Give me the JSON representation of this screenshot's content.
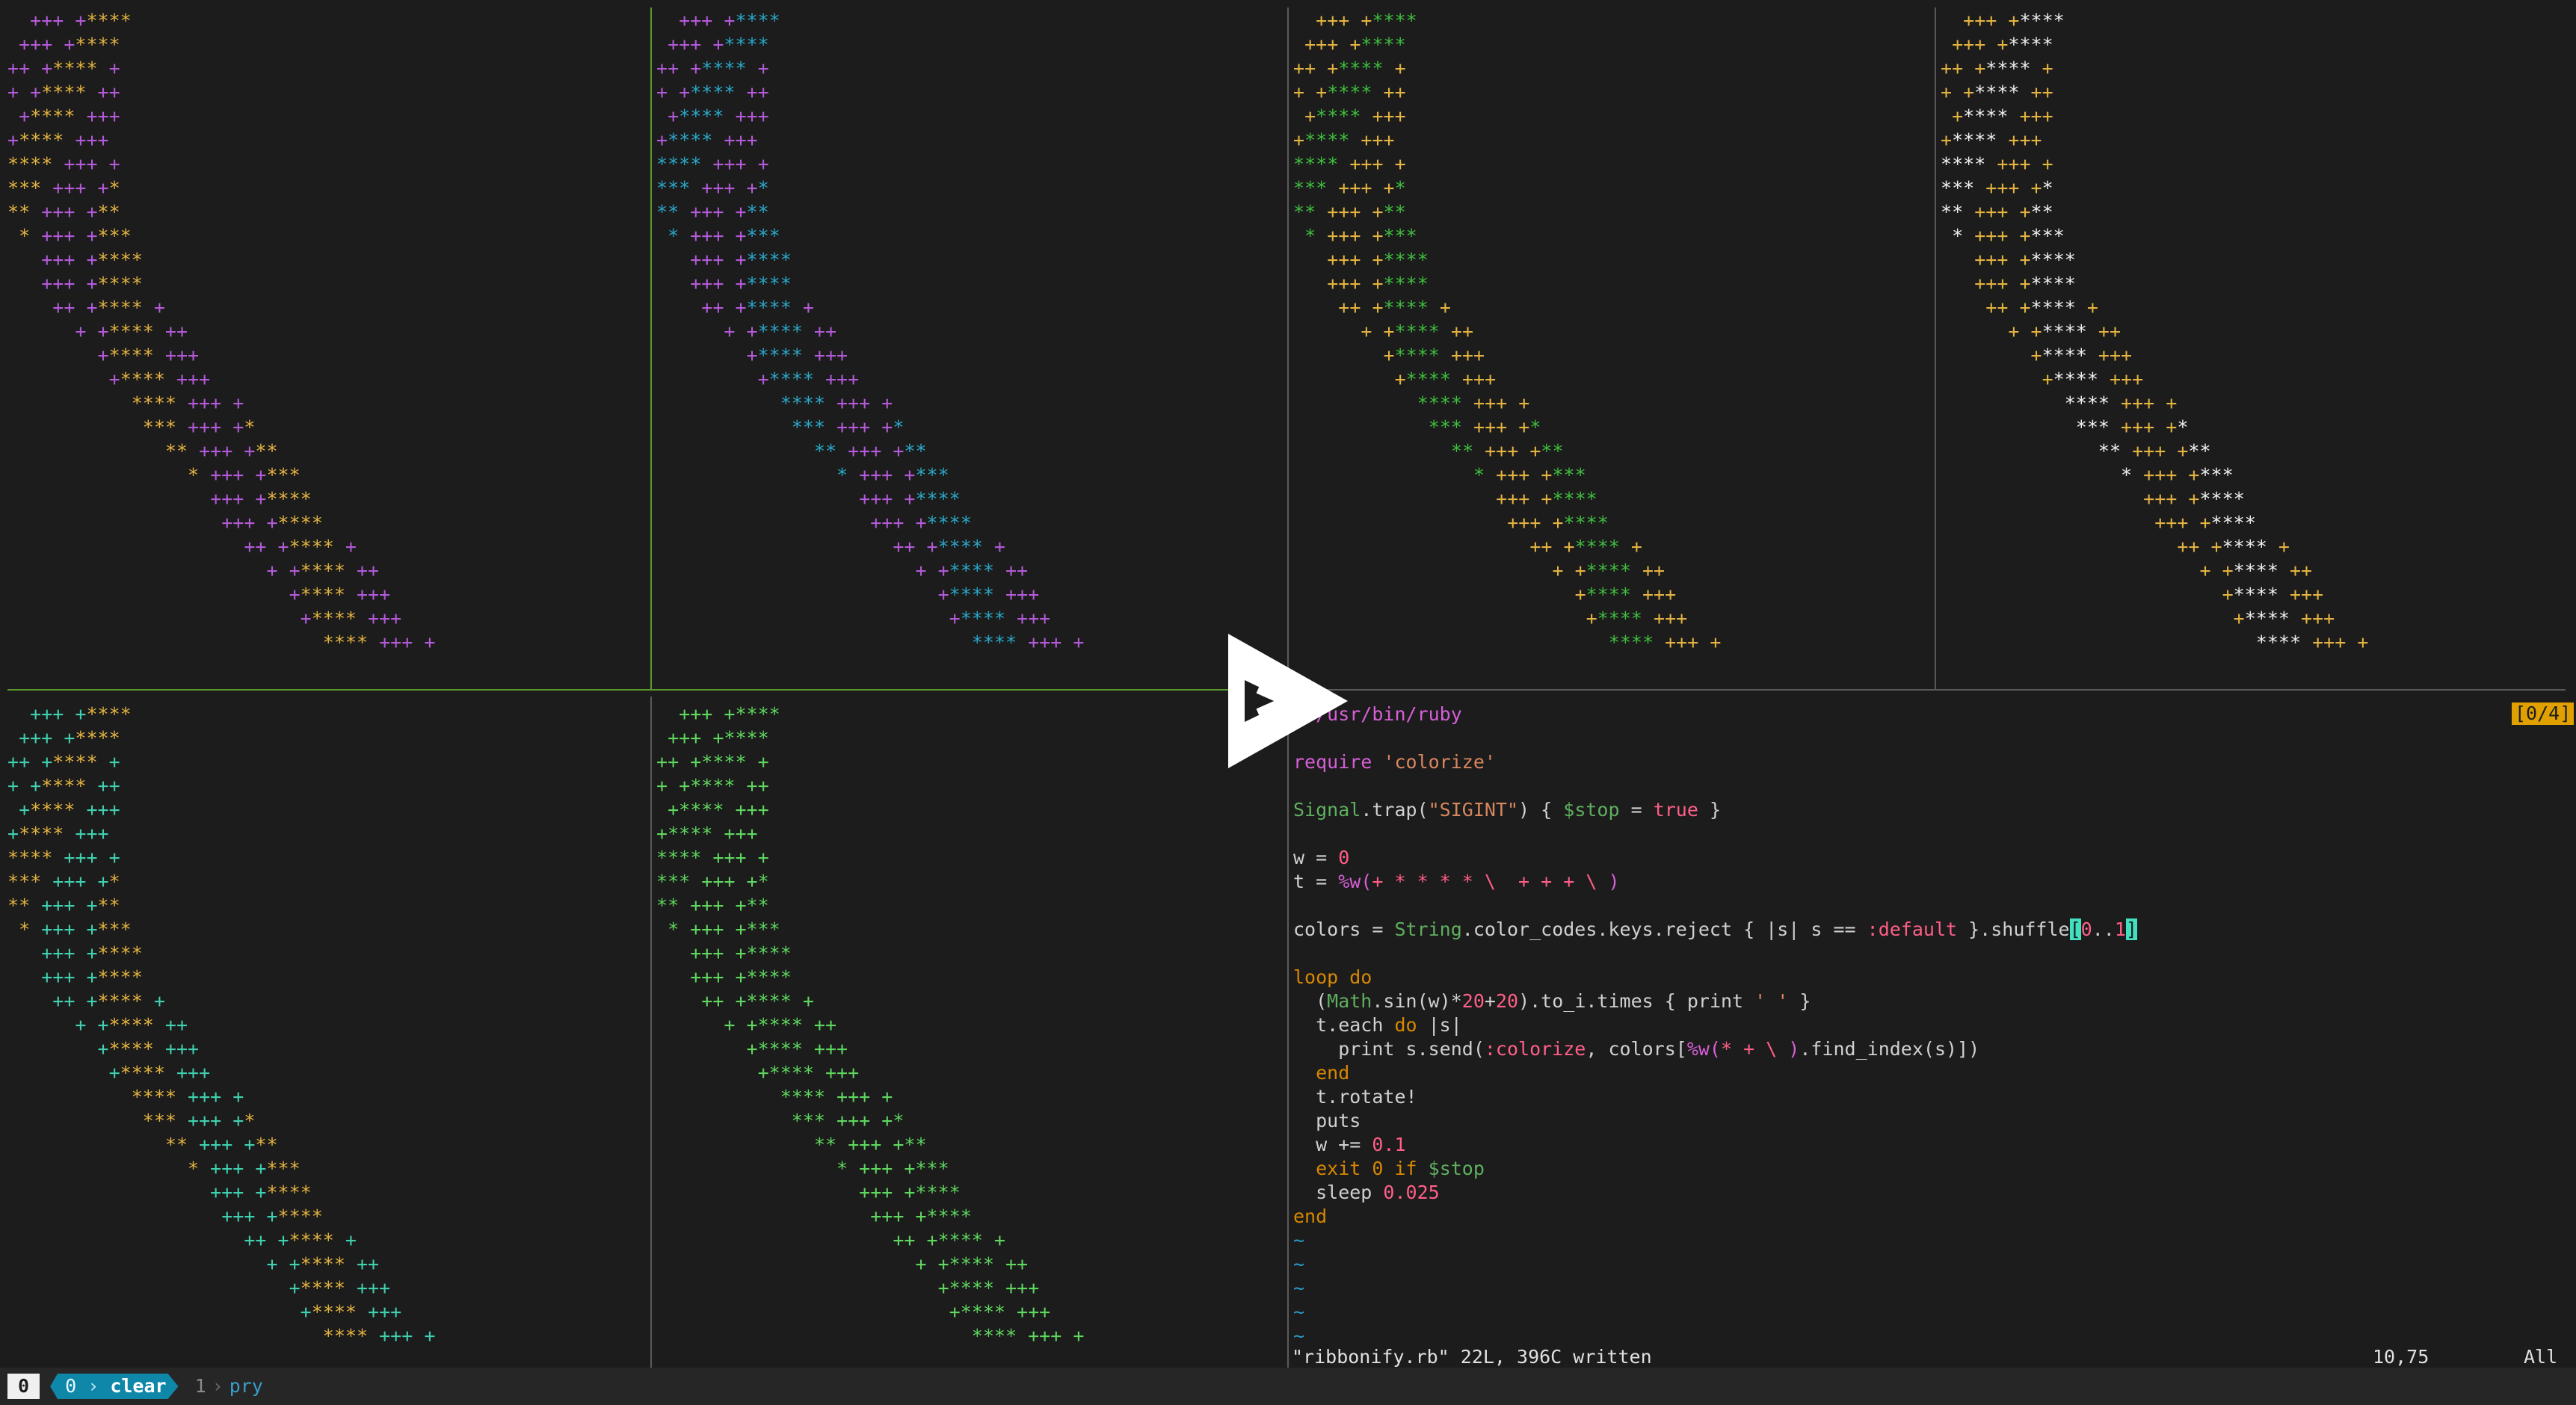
{
  "panes": {
    "top1": {
      "colors": [
        "c-p",
        "c-y"
      ]
    },
    "top2": {
      "colors": [
        "c-p",
        "c-c"
      ]
    },
    "top3": {
      "colors": [
        "c-y",
        "c-g"
      ]
    },
    "top4": {
      "colors": [
        "c-y",
        "c-w"
      ]
    },
    "bot1": {
      "colors": [
        "c-t",
        "c-y"
      ]
    },
    "bot2": {
      "colors": [
        "c-lg",
        "c-lg"
      ]
    }
  },
  "ribbon_lines": [
    "  +++ +****",
    " +++ +****",
    "++ +**** +",
    "+ +**** ++",
    " +**** +++",
    "+**** +++",
    "**** +++ +",
    "*** +++ +*",
    "** +++ +**",
    " * +++ +***",
    "   +++ +****",
    "   +++ +****",
    "    ++ +**** +",
    "      + +**** ++",
    "        +**** +++",
    "         +**** +++",
    "           **** +++ +",
    "            *** +++ +*",
    "              ** +++ +**",
    "                * +++ +***",
    "                  +++ +****",
    "                   +++ +****",
    "                     ++ +**** +",
    "                       + +**** ++",
    "                         +**** +++",
    "                          +**** +++",
    "                            **** +++ +"
  ],
  "vim": {
    "lines": [
      "#!/usr/bin/ruby",
      "",
      "require 'colorize'",
      "",
      "Signal.trap(\"SIGINT\") { $stop = true }",
      "",
      "w = 0",
      "t = %w(+ * * * * \\  + + + \\ )",
      "",
      "colors = String.color_codes.keys.reject { |s| s == :default }.shuffle[0..1]",
      "",
      "loop do",
      "  (Math.sin(w)*20+20).to_i.times { print ' ' }",
      "  t.each do |s|",
      "    print s.send(:colorize, colors[%w(* + \\ ).find_index(s)])",
      "  end",
      "  t.rotate!",
      "  puts",
      "  w += 0.1",
      "  exit 0 if $stop",
      "  sleep 0.025",
      "end",
      "~",
      "~",
      "~",
      "~",
      "~"
    ],
    "status_msg": "\"ribbonify.rb\" 22L, 396C written",
    "cursor_pos": "10,75",
    "scroll": "All",
    "search_count": "[0/4]"
  },
  "tmux": {
    "session": "0",
    "active_index": "0",
    "active_name": "clear",
    "other_index": "1",
    "other_name": "pry"
  }
}
